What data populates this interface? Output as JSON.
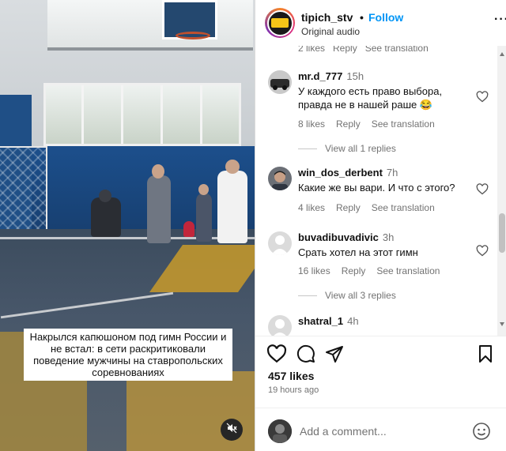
{
  "video": {
    "caption": "Накрылся капюшоном под гимн России и не встал: в сети раскритиковали поведение мужчины на ставропольских соревнованиях",
    "mute_icon": "speaker-muted-icon"
  },
  "header": {
    "username": "tipich_stv",
    "separator": "•",
    "follow_label": "Follow",
    "audio": "Original audio",
    "more": "···"
  },
  "comments": {
    "top_meta": "2 likes   Reply   See translation",
    "items": [
      {
        "username": "mr.d_777",
        "time": "15h",
        "text": "У каждого есть право выбора, правда не в нашей раше 😂",
        "likes": "8 likes",
        "reply": "Reply",
        "translate": "See translation",
        "replies": "View all 1 replies"
      },
      {
        "username": "win_dos_derbent",
        "time": "7h",
        "text": "Какие же вы вари. И что с этого?",
        "likes": "4 likes",
        "reply": "Reply",
        "translate": "See translation"
      },
      {
        "username": "buvadibuvadivic",
        "time": "3h",
        "text": "Срать хотел на этот гимн",
        "likes": "16 likes",
        "reply": "Reply",
        "translate": "See translation",
        "replies": "View all 3 replies"
      },
      {
        "username": "shatral_1",
        "time": "4h",
        "text": ""
      }
    ]
  },
  "footer": {
    "likes": "457 likes",
    "ago": "19 hours ago",
    "add_comment_placeholder": "Add a comment..."
  },
  "colors": {
    "follow": "#0095f6",
    "muted_text": "#737373"
  }
}
